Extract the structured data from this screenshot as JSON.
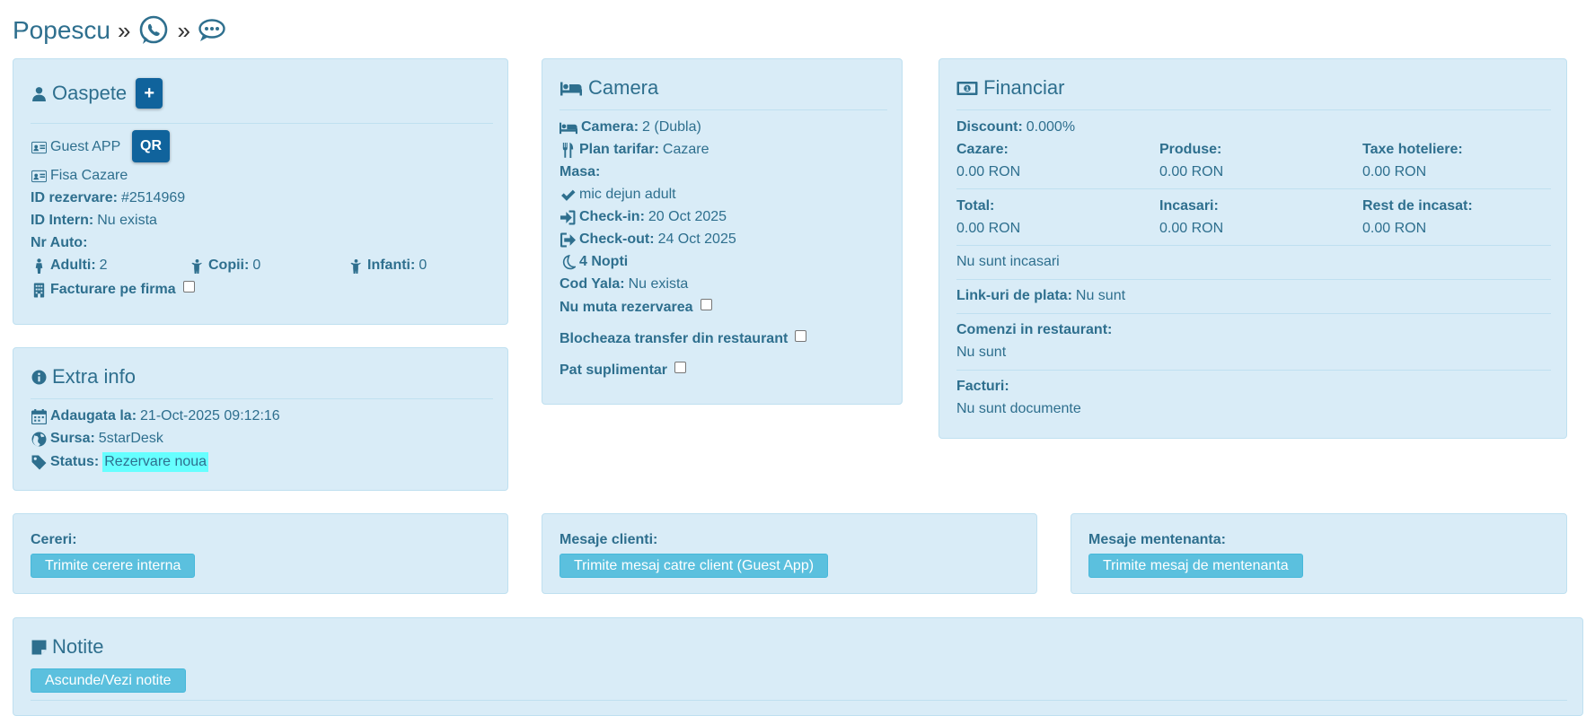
{
  "breadcrumb": {
    "name": "Popescu",
    "sep": "»"
  },
  "guest": {
    "title": "Oaspete",
    "add_label": "+",
    "guest_app": "Guest APP",
    "qr_label": "QR",
    "fisa": "Fisa Cazare",
    "id_rez_label": "ID rezervare:",
    "id_rez_value": "#2514969",
    "id_intern_label": "ID Intern:",
    "id_intern_value": "Nu exista",
    "nr_auto_label": "Nr Auto:",
    "adulti_label": "Adulti:",
    "adulti_value": "2",
    "copii_label": "Copii:",
    "copii_value": "0",
    "infanti_label": "Infanti:",
    "infanti_value": "0",
    "facturare_label": "Facturare pe firma"
  },
  "extra": {
    "title": "Extra info",
    "adaugata_label": "Adaugata la:",
    "adaugata_value": "21-Oct-2025 09:12:16",
    "sursa_label": "Sursa:",
    "sursa_value": "5starDesk",
    "status_label": "Status:",
    "status_value": "Rezervare noua",
    "status_color": "#66ffff"
  },
  "camera": {
    "title": "Camera",
    "camera_label": "Camera:",
    "camera_value": "2 (Dubla)",
    "plan_label": "Plan tarifar:",
    "plan_value": "Cazare",
    "masa_label": "Masa:",
    "masa_item": "mic dejun adult",
    "checkin_label": "Check-in:",
    "checkin_value": "20 Oct 2025",
    "checkout_label": "Check-out:",
    "checkout_value": "24 Oct 2025",
    "nopti": "4 Nopti",
    "cod_label": "Cod Yala:",
    "cod_value": "Nu exista",
    "nu_muta": "Nu muta rezervarea",
    "blocheaza": "Blocheaza transfer din restaurant",
    "pat": "Pat suplimentar"
  },
  "financiar": {
    "title": "Financiar",
    "discount_label": "Discount:",
    "discount_value": "0.000%",
    "cazare_label": "Cazare:",
    "cazare_value": "0.00 RON",
    "produse_label": "Produse:",
    "produse_value": "0.00 RON",
    "taxe_label": "Taxe hoteliere:",
    "taxe_value": "0.00 RON",
    "total_label": "Total:",
    "total_value": "0.00 RON",
    "incasari_label": "Incasari:",
    "incasari_value": "0.00 RON",
    "rest_label": "Rest de incasat:",
    "rest_value": "0.00 RON",
    "nu_incasari": "Nu sunt incasari",
    "link_label": "Link-uri de plata:",
    "link_value": "Nu sunt",
    "comenzi_label": "Comenzi in restaurant:",
    "comenzi_value": "Nu sunt",
    "facturi_label": "Facturi:",
    "facturi_value": "Nu sunt documente"
  },
  "cereri": {
    "label": "Cereri:",
    "button": "Trimite cerere interna"
  },
  "mesaje_clienti": {
    "label": "Mesaje clienti:",
    "button": "Trimite mesaj catre client (Guest App)"
  },
  "mesaje_mentenanta": {
    "label": "Mesaje mentenanta:",
    "button": "Trimite mesaj de mentenanta"
  },
  "notite": {
    "title": "Notite",
    "button": "Ascunde/Vezi notite"
  },
  "colors": {
    "panel_bg": "#d9ecf7",
    "text": "#2e6f8e",
    "btn_dark": "#10639c",
    "btn_light": "#5bc0de"
  }
}
